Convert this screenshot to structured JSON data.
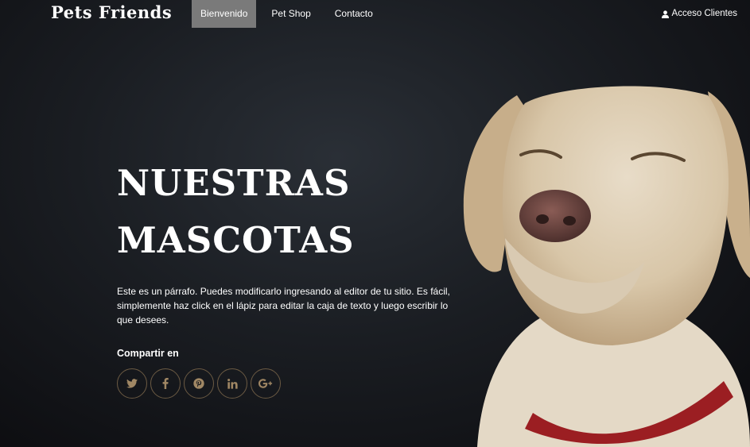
{
  "nav": {
    "logo": "Pets Friends",
    "items": [
      {
        "label": "Bienvenido",
        "active": true
      },
      {
        "label": "Pet Shop",
        "active": false
      },
      {
        "label": "Contacto",
        "active": false
      }
    ],
    "client_access": "Acceso Clientes",
    "client_icon": "user-icon"
  },
  "hero": {
    "title_line1": "NUESTRAS",
    "title_line2": "MASCOTAS",
    "paragraph": "Este es un párrafo. Puedes modificarlo ingresando al editor de tu sitio. Es fácil, simplemente haz click en el lápiz para editar la caja de texto y luego escribir lo que desees.",
    "share_label": "Compartir en",
    "socials": [
      "twitter-icon",
      "facebook-icon",
      "pinterest-icon",
      "linkedin-icon",
      "google-plus-icon"
    ],
    "image": "labrador-dog-photo"
  },
  "colors": {
    "active_menu": "#7a7a7a",
    "social_border": "#6b5a43",
    "social_icon": "#a08764"
  }
}
